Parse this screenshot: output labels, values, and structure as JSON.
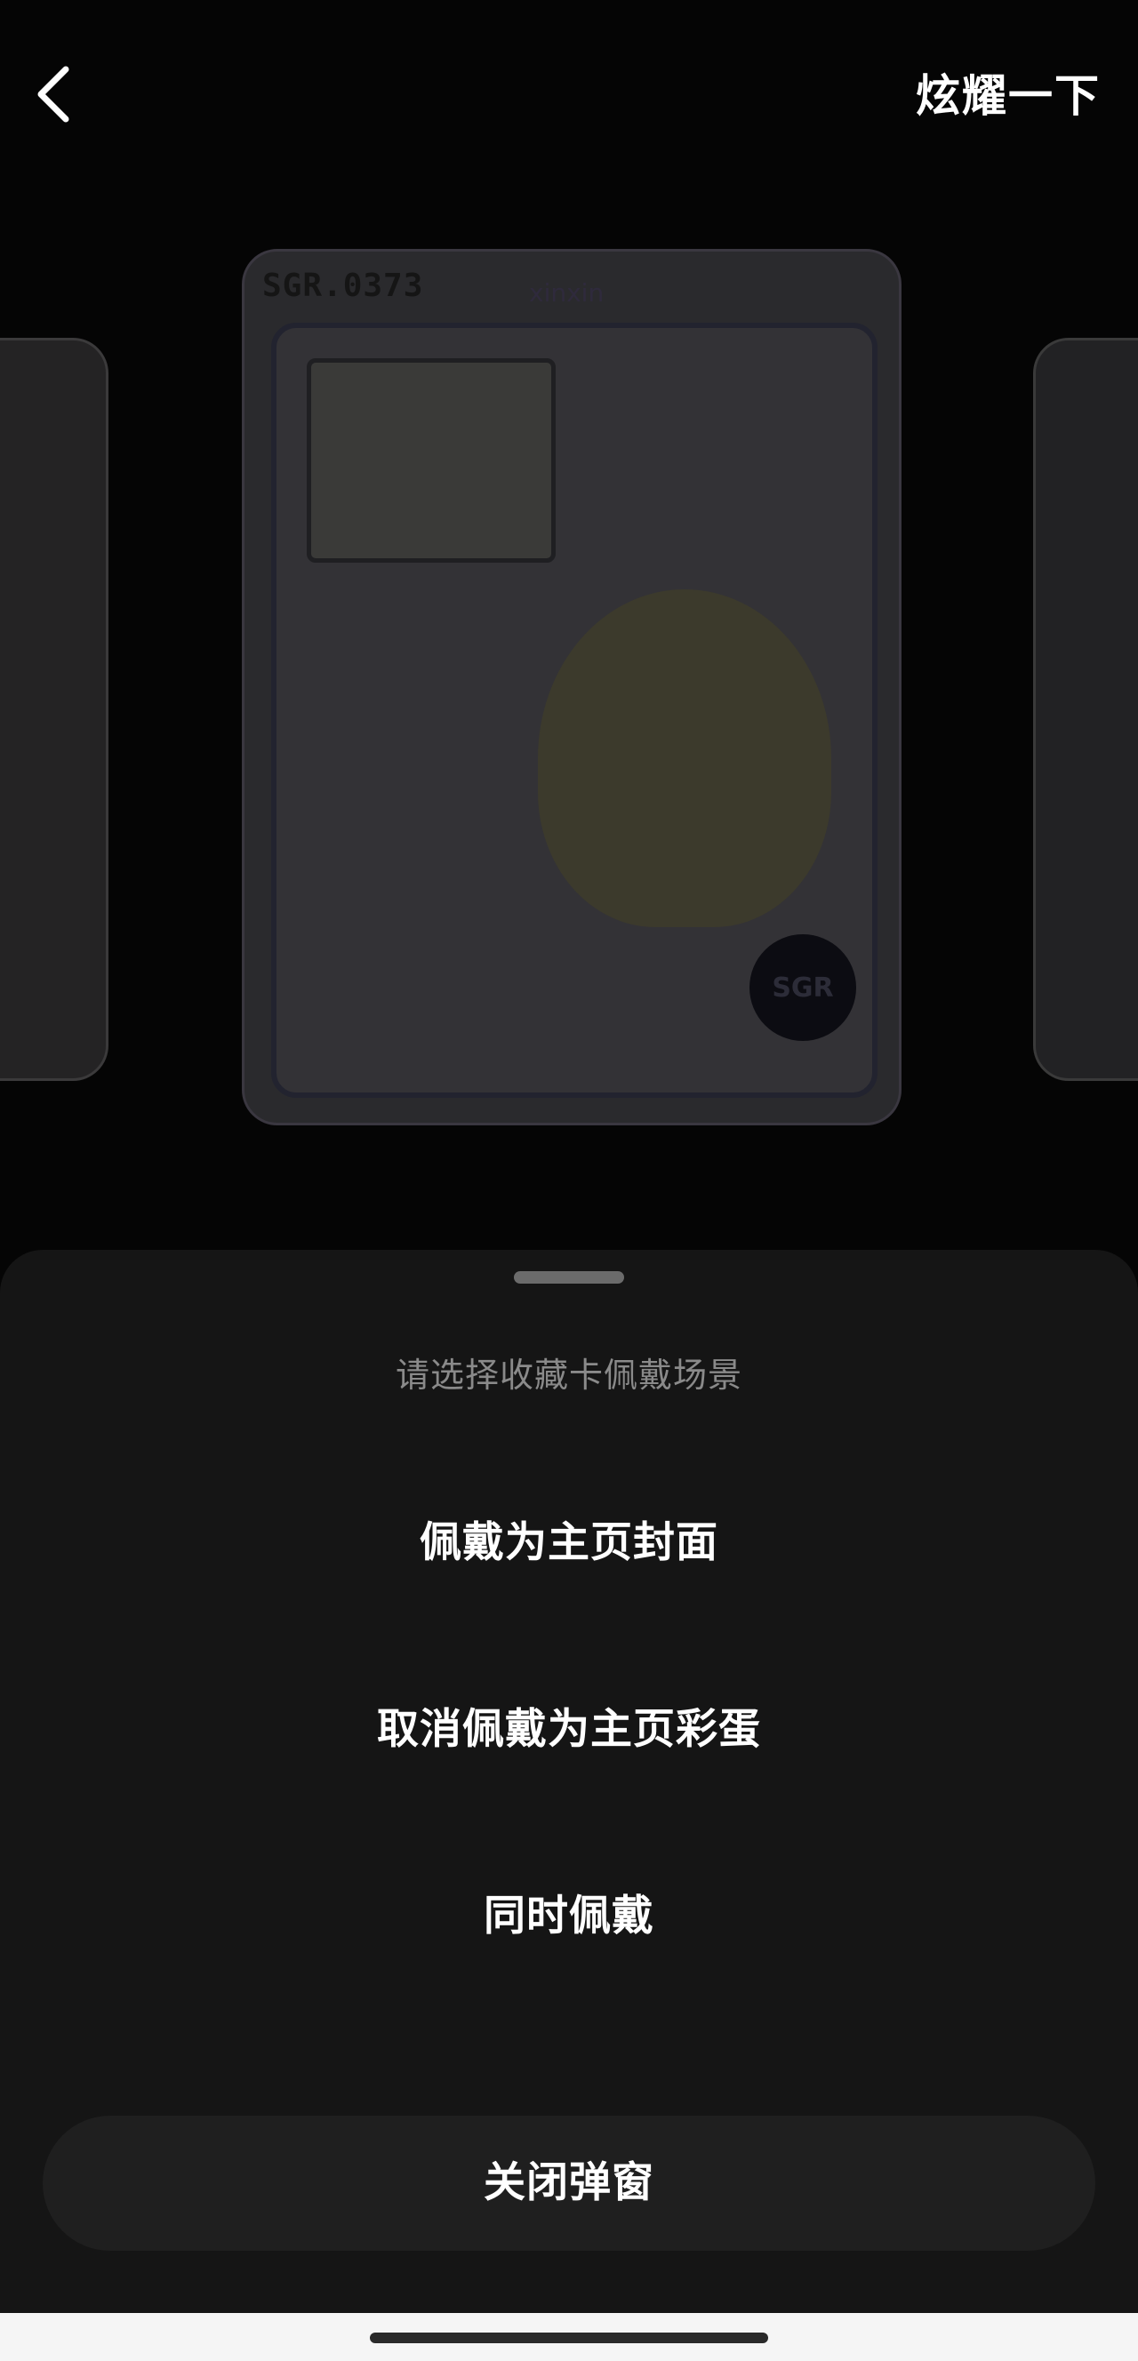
{
  "header": {
    "back_icon": "chevron-left-icon",
    "action_label": "炫耀一下"
  },
  "cards": {
    "main": {
      "serial": "SGR.0373",
      "owner": "xinxin",
      "badge": "SGR"
    }
  },
  "sheet": {
    "title": "请选择收藏卡佩戴场景",
    "options": [
      {
        "label": "佩戴为主页封面"
      },
      {
        "label": "取消佩戴为主页彩蛋"
      },
      {
        "label": "同时佩戴"
      }
    ],
    "close_label": "关闭弹窗"
  },
  "colors": {
    "sheet_background": "#151515",
    "close_button_background": "#1f1f1f",
    "title_text": "#8a8a8a",
    "option_text": "#ffffff"
  }
}
